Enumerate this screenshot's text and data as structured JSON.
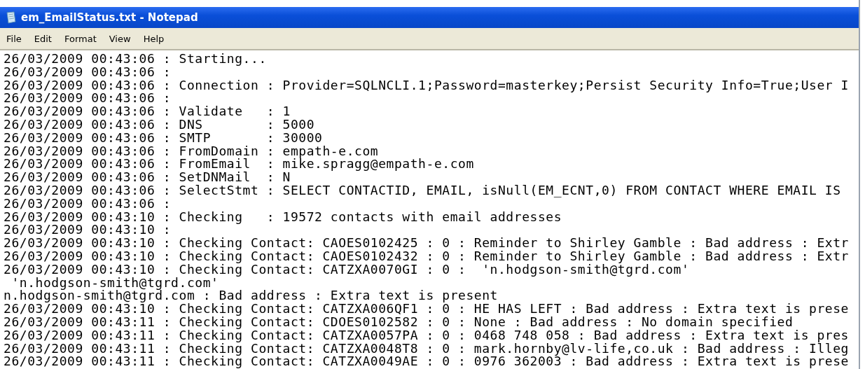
{
  "window": {
    "title": "em_EmailStatus.txt - Notepad"
  },
  "menu": [
    "File",
    "Edit",
    "Format",
    "View",
    "Help"
  ],
  "lines": [
    "26/03/2009 00:43:06 : Starting...",
    "26/03/2009 00:43:06 :",
    "26/03/2009 00:43:06 : Connection : Provider=SQLNCLI.1;Password=masterkey;Persist Security Info=True;User I",
    "26/03/2009 00:43:06 :",
    "26/03/2009 00:43:06 : Validate   : 1",
    "26/03/2009 00:43:06 : DNS        : 5000",
    "26/03/2009 00:43:06 : SMTP       : 30000",
    "26/03/2009 00:43:06 : FromDomain : empath-e.com",
    "26/03/2009 00:43:06 : FromEmail  : mike.spragg@empath-e.com",
    "26/03/2009 00:43:06 : SetDNMail  : N",
    "26/03/2009 00:43:06 : SelectStmt : SELECT CONTACTID, EMAIL, isNull(EM_ECNT,0) FROM CONTACT WHERE EMAIL IS",
    "26/03/2009 00:43:06 :",
    "26/03/2009 00:43:10 : Checking   : 19572 contacts with email addresses",
    "26/03/2009 00:43:10 :",
    "26/03/2009 00:43:10 : Checking Contact: CAOES0102425 : 0 : Reminder to Shirley Gamble : Bad address : Extr",
    "26/03/2009 00:43:10 : Checking Contact: CAOES0102432 : 0 : Reminder to Shirley Gamble : Bad address : Extr",
    "26/03/2009 00:43:10 : Checking Contact: CATZXA0070GI : 0 :  'n.hodgson-smith@tgrd.com'",
    " 'n.hodgson-smith@tgrd.com'",
    "n.hodgson-smith@tgrd.com : Bad address : Extra text is present",
    "26/03/2009 00:43:10 : Checking Contact: CATZXA006QF1 : 0 : HE HAS LEFT : Bad address : Extra text is prese",
    "26/03/2009 00:43:11 : Checking Contact: CDOES0102582 : 0 : None : Bad address : No domain specified",
    "26/03/2009 00:43:11 : Checking Contact: CATZXA0057PA : 0 : 0468 748 058 : Bad address : Extra text is pres",
    "26/03/2009 00:43:11 : Checking Contact: CATZXA0048T8 : 0 : mark.hornby@lv-life,co.uk : Bad address : Illeg",
    "26/03/2009 00:43:11 : Checking Contact: CATZXA0049AE : 0 : 0976 362003 : Bad address : Extra text is prese"
  ]
}
